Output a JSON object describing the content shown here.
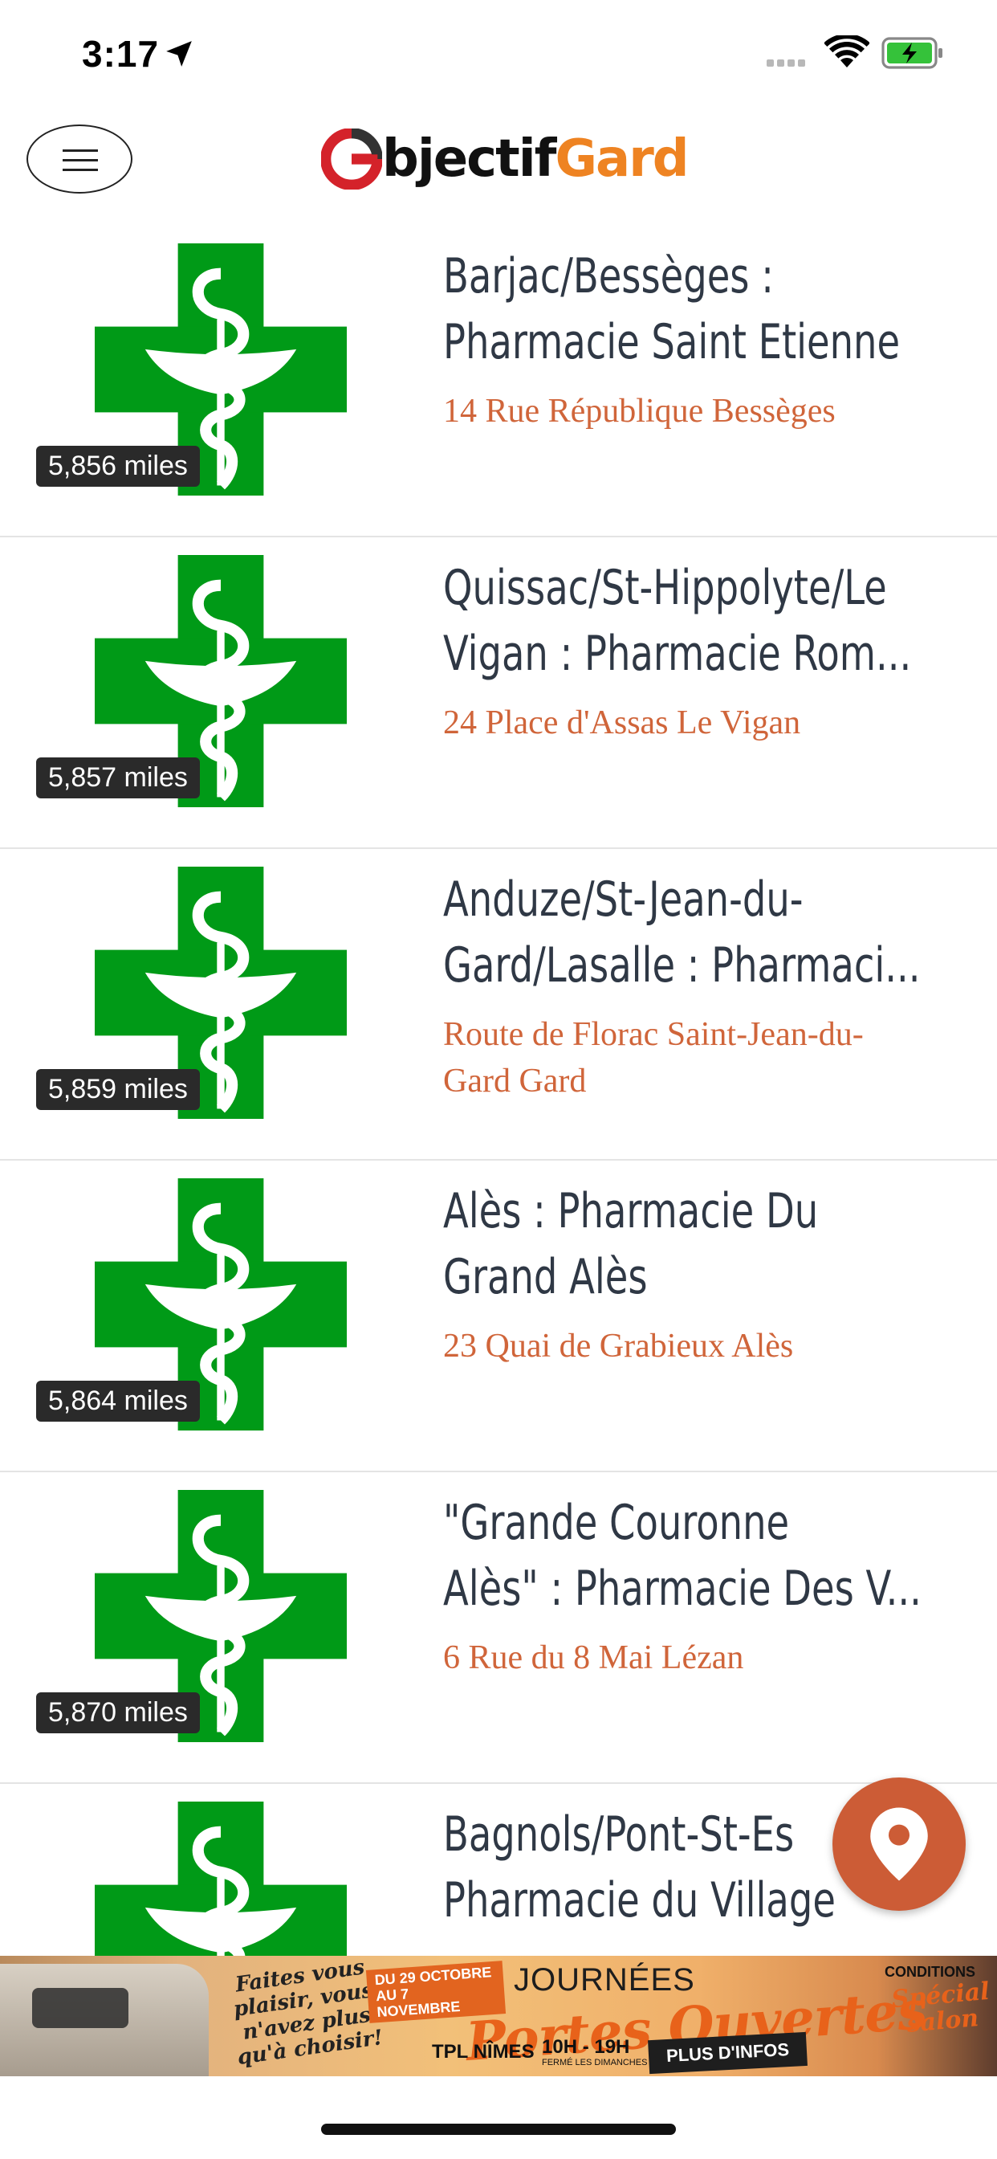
{
  "status_bar": {
    "time": "3:17"
  },
  "header": {
    "logo_part1": "bjectif",
    "logo_part2": "Gard"
  },
  "pharmacies": [
    {
      "title_line1": "Barjac/Bessèges :",
      "title_line2": "Pharmacie Saint Etienne",
      "address_line1": "14 Rue République Bessèges",
      "address_line2": "",
      "distance": "5,856 miles"
    },
    {
      "title_line1": "Quissac/St-Hippolyte/Le",
      "title_line2": "Vigan : Pharmacie Rom...",
      "address_line1": "24 Place d'Assas Le Vigan",
      "address_line2": "",
      "distance": "5,857 miles"
    },
    {
      "title_line1": "Anduze/St-Jean-du-",
      "title_line2": "Gard/Lasalle : Pharmaci...",
      "address_line1": "Route de Florac Saint-Jean-du-",
      "address_line2": "Gard Gard",
      "distance": "5,859 miles"
    },
    {
      "title_line1": "Alès : Pharmacie Du",
      "title_line2": "Grand Alès",
      "address_line1": "23 Quai de Grabieux Alès",
      "address_line2": "",
      "distance": "5,864 miles"
    },
    {
      "title_line1": "\"Grande Couronne",
      "title_line2": "Alès\" : Pharmacie Des V...",
      "address_line1": "6 Rue du 8 Mai Lézan",
      "address_line2": "",
      "distance": "5,870 miles"
    },
    {
      "title_line1": "Bagnols/Pont-St-Es",
      "title_line2": "Pharmacie du Village",
      "address_line1": "",
      "address_line2": "",
      "distance": ""
    }
  ],
  "banner": {
    "slogan": "Faites vous plaisir, vous n'avez plus qu'à choisir!",
    "date": "DU 29 OCTOBRE AU 7 NOVEMBRE",
    "journees": "JOURNÉES",
    "portes": "Portes Ouvertes",
    "location": "TPL NÎMES",
    "hours": "10H - 19H",
    "closed": "FERMÉ LES DIMANCHES",
    "more": "PLUS D'INFOS",
    "conditions": "CONDITIONS",
    "special": "Spécial salon"
  },
  "colors": {
    "pharmacy_green": "#009a17",
    "title": "#2f3845",
    "address": "#d0653a",
    "accent": "#ee8322",
    "fab": "#cc5c36"
  },
  "icons": [
    "location-arrow-icon",
    "wifi-icon",
    "battery-charging-icon",
    "hamburger-menu-icon",
    "pharmacy-cross-icon",
    "map-pin-icon"
  ]
}
